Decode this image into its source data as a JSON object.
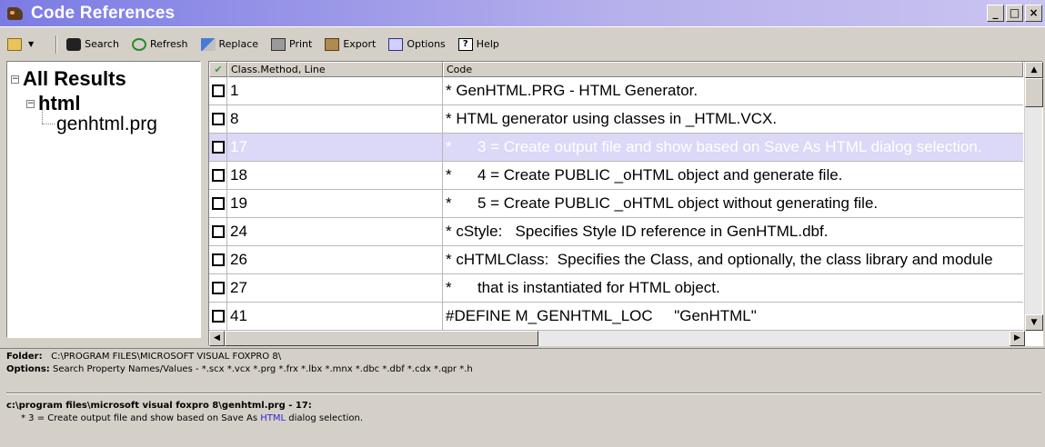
{
  "window": {
    "title": "Code References",
    "controls": [
      "_",
      "□",
      "×"
    ]
  },
  "toolbar": {
    "items": [
      {
        "label": "Search",
        "icon": "binoculars-icon"
      },
      {
        "label": "Refresh",
        "icon": "refresh-icon"
      },
      {
        "label": "Replace",
        "icon": "replace-icon"
      },
      {
        "label": "Print",
        "icon": "printer-icon"
      },
      {
        "label": "Export",
        "icon": "export-icon"
      },
      {
        "label": "Options",
        "icon": "options-icon"
      },
      {
        "label": "Help",
        "icon": "help-icon"
      }
    ]
  },
  "tree": {
    "root": "All Results",
    "folder": "html",
    "file": "genhtml.prg"
  },
  "grid": {
    "headers": {
      "check": "✔",
      "line": "Class.Method, Line",
      "code": "Code"
    },
    "rows": [
      {
        "line": "1",
        "code": "* GenHTML.PRG - HTML Generator.",
        "selected": false
      },
      {
        "line": "8",
        "code": "* HTML generator using classes in _HTML.VCX.",
        "selected": false
      },
      {
        "line": "17",
        "code": "*      3 = Create output file and show based on Save As HTML dialog selection.",
        "selected": true
      },
      {
        "line": "18",
        "code": "*      4 = Create PUBLIC _oHTML object and generate file.",
        "selected": false
      },
      {
        "line": "19",
        "code": "*      5 = Create PUBLIC _oHTML object without generating file.",
        "selected": false
      },
      {
        "line": "24",
        "code": "* cStyle:   Specifies Style ID reference in GenHTML.dbf.",
        "selected": false
      },
      {
        "line": "26",
        "code": "* cHTMLClass:  Specifies the Class, and optionally, the class library and module",
        "selected": false
      },
      {
        "line": "27",
        "code": "*      that is instantiated for HTML object.",
        "selected": false
      },
      {
        "line": "41",
        "code": "#DEFINE M_GENHTML_LOC     \"GenHTML\"",
        "selected": false
      }
    ]
  },
  "info": {
    "folder_label": "Folder:",
    "folder_value": "C:\\PROGRAM FILES\\MICROSOFT VISUAL FOXPRO 8\\",
    "options_label": "Options:",
    "options_value": "Search Property Names/Values - *.scx *.vcx *.prg *.frx *.lbx *.mnx *.dbc *.dbf *.cdx *.qpr *.h"
  },
  "detail": {
    "path": "c:\\program files\\microsoft visual foxpro 8\\genhtml.prg - 17:",
    "text_before": "* 3 = Create output file and show based on Save As ",
    "text_kw": "HTML",
    "text_after": " dialog selection."
  },
  "colors": {
    "selection": "#dcd8f8",
    "title_start": "#7b7be4",
    "title_end": "#c9c4f0",
    "keyword": "#2a2ad8"
  }
}
